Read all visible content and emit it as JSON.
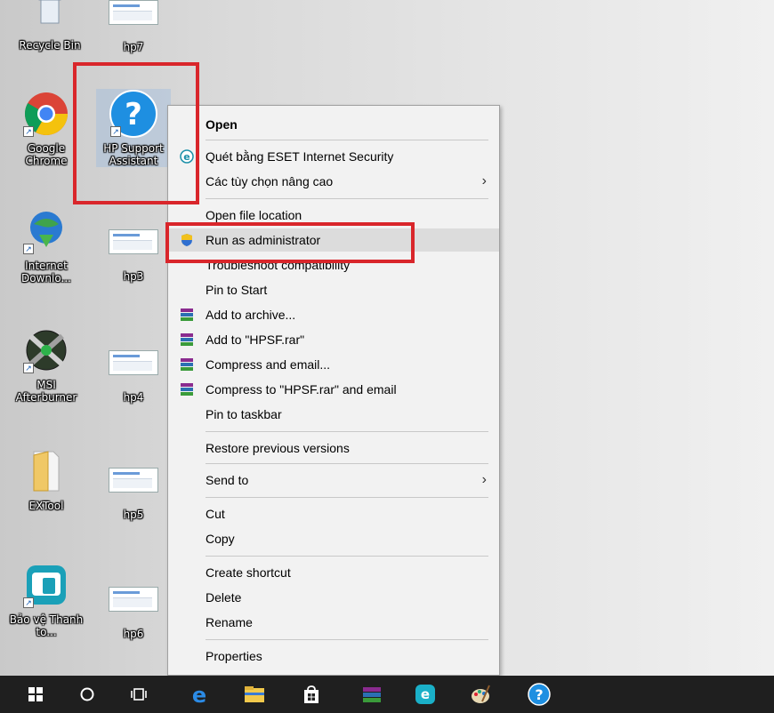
{
  "desktop": {
    "icons": [
      {
        "label": "Recycle Bin"
      },
      {
        "label": "hp7"
      },
      {
        "label": "Google Chrome"
      },
      {
        "label": "HP Support Assistant"
      },
      {
        "label": "Internet Downlo..."
      },
      {
        "label": "hp3"
      },
      {
        "label": "MSI Afterburner"
      },
      {
        "label": "hp4"
      },
      {
        "label": "EXTool"
      },
      {
        "label": "hp5"
      },
      {
        "label": "Bảo vệ Thanh to..."
      },
      {
        "label": "hp6"
      }
    ]
  },
  "context_menu": {
    "items": [
      {
        "label": "Open"
      },
      {
        "label": "Quét bằng ESET Internet Security"
      },
      {
        "label": "Các tùy chọn nâng cao"
      },
      {
        "label": "Open file location"
      },
      {
        "label": "Run as administrator"
      },
      {
        "label": "Troubleshoot compatibility"
      },
      {
        "label": "Pin to Start"
      },
      {
        "label": "Add to archive..."
      },
      {
        "label": "Add to \"HPSF.rar\""
      },
      {
        "label": "Compress and email..."
      },
      {
        "label": "Compress to \"HPSF.rar\" and email"
      },
      {
        "label": "Pin to taskbar"
      },
      {
        "label": "Restore previous versions"
      },
      {
        "label": "Send to"
      },
      {
        "label": "Cut"
      },
      {
        "label": "Copy"
      },
      {
        "label": "Create shortcut"
      },
      {
        "label": "Delete"
      },
      {
        "label": "Rename"
      },
      {
        "label": "Properties"
      }
    ],
    "submenu_arrow": "›"
  },
  "taskbar": {
    "items": [
      "start-icon",
      "search-icon",
      "task-view-icon",
      "edge-icon",
      "file-explorer-icon",
      "store-icon",
      "winrar-icon",
      "eset-icon",
      "paint-icon",
      "hp-support-icon"
    ]
  },
  "colors": {
    "highlight_box": "#d9262b",
    "menu_bg": "#f2f2f2",
    "taskbar_bg": "#1f1f1f",
    "hover_bg": "#dcdcdc"
  }
}
